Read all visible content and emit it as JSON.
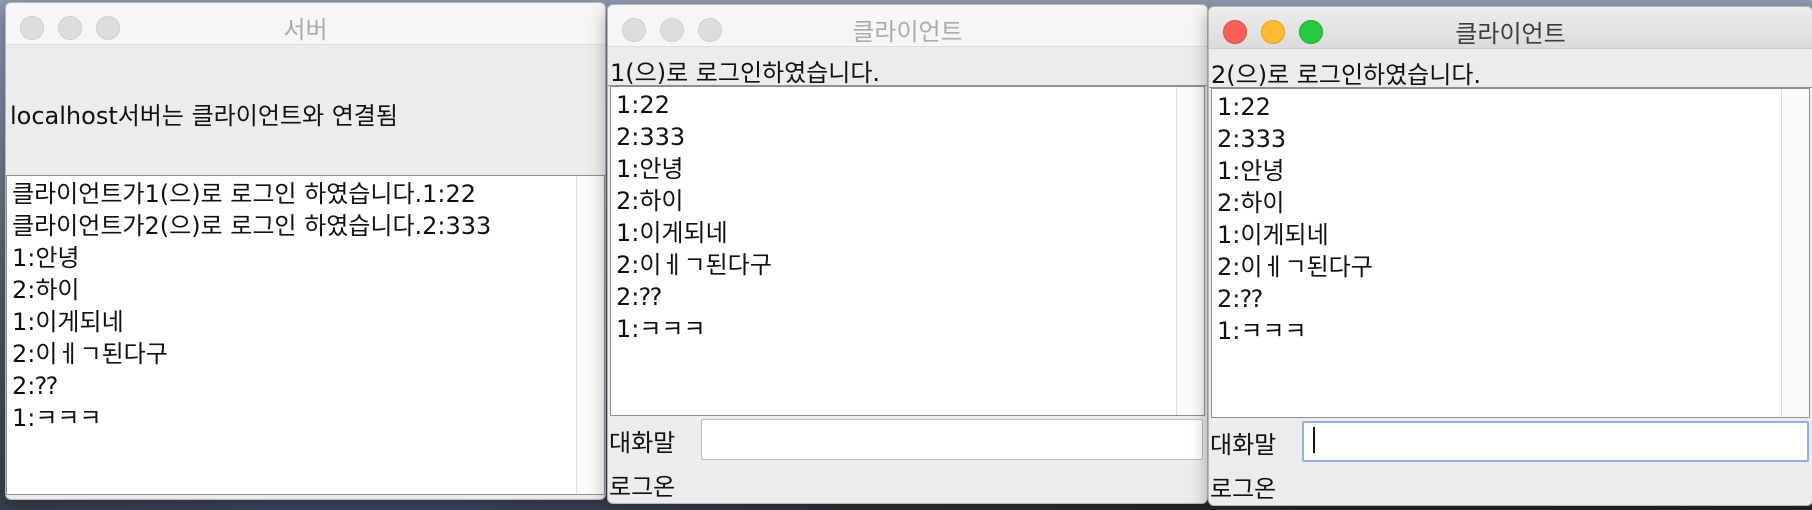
{
  "server": {
    "title": "서버",
    "status": "localhost서버는 클라이언트와 연결됨",
    "log": [
      "클라이언트가1(으)로 로그인 하였습니다.1:22",
      "클라이언트가2(으)로 로그인 하였습니다.2:333",
      "1:안녕",
      "2:하이",
      "1:이게되네",
      "2:이ㅔㄱ된다구",
      "2:⁇",
      "1:ㅋㅋㅋ"
    ]
  },
  "clients": [
    {
      "title": "클라이언트",
      "login_message": "1(으)로 로그인하였습니다.",
      "messages": [
        "1:22",
        "2:333",
        "1:안녕",
        "2:하이",
        "1:이게되네",
        "2:이ㅔㄱ된다구",
        "2:⁇",
        "1:ㅋㅋㅋ"
      ],
      "input_label": "대화말",
      "input_value": "",
      "login_status": "로그온"
    },
    {
      "title": "클라이언트",
      "login_message": "2(으)로 로그인하였습니다.",
      "messages": [
        "1:22",
        "2:333",
        "1:안녕",
        "2:하이",
        "1:이게되네",
        "2:이ㅔㄱ된다구",
        "2:⁇",
        "1:ㅋㅋㅋ"
      ],
      "input_label": "대화말",
      "input_value": "",
      "login_status": "로그온"
    }
  ]
}
